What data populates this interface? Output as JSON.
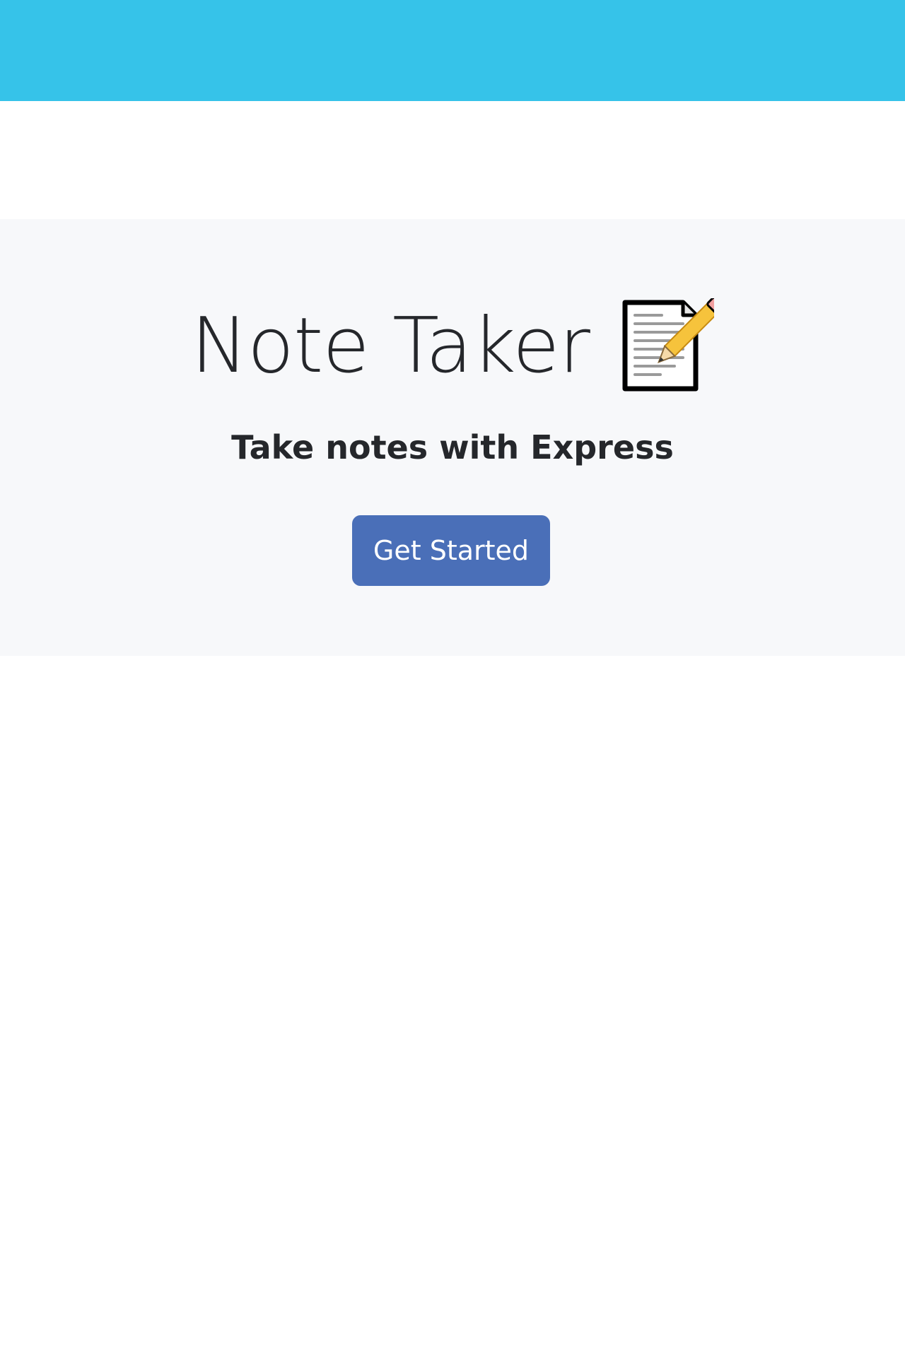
{
  "navbar": {
    "color": "#36c3e9"
  },
  "hero": {
    "title": "Note Taker",
    "title_icon": "memo-icon",
    "subtitle": "Take notes with Express",
    "cta_label": "Get Started",
    "background": "#f7f8fa"
  },
  "colors": {
    "primary_button": "#4a6fb8",
    "text": "#25272b"
  }
}
